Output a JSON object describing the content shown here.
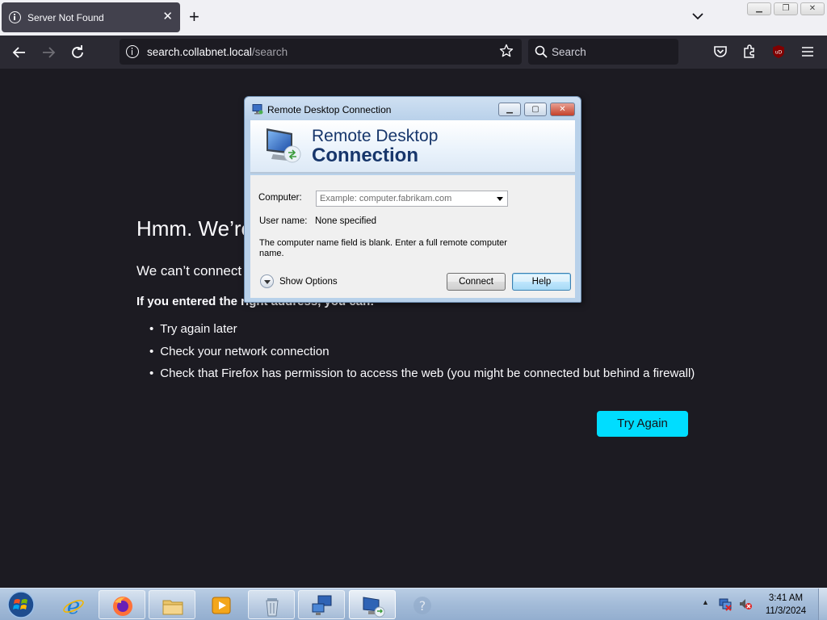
{
  "browser": {
    "tab_title": "Server Not Found",
    "url_host": "search.collabnet.local",
    "url_path": "/search",
    "search_placeholder": "Search"
  },
  "error_page": {
    "title": "Hmm. We’re",
    "description": "We can’t connect",
    "if_heading": "If you entered the right address, you can:",
    "suggestions": [
      "Try again later",
      "Check your network connection",
      "Check that Firefox has permission to access the web (you might be connected but behind a firewall)"
    ],
    "try_again_label": "Try Again"
  },
  "rdp_dialog": {
    "window_title": "Remote Desktop Connection",
    "banner_line1": "Remote Desktop",
    "banner_line2": "Connection",
    "computer_label": "Computer:",
    "computer_placeholder": "Example: computer.fabrikam.com",
    "user_name_label": "User name:",
    "user_name_value": "None specified",
    "message": "The computer name field is blank. Enter a full remote computer name.",
    "show_options_label": "Show Options",
    "connect_label": "Connect",
    "help_label": "Help"
  },
  "taskbar": {
    "time": "3:41 AM",
    "date": "11/3/2024",
    "items": [
      "firefox",
      "file-explorer",
      "media-player",
      "recycle-bin",
      "network-connections",
      "remote-desktop-connection",
      "help-and-support"
    ]
  },
  "colors": {
    "page_bg": "#1c1b22",
    "accent_button": "#00ddff",
    "rdp_title_text": "#17366b"
  }
}
